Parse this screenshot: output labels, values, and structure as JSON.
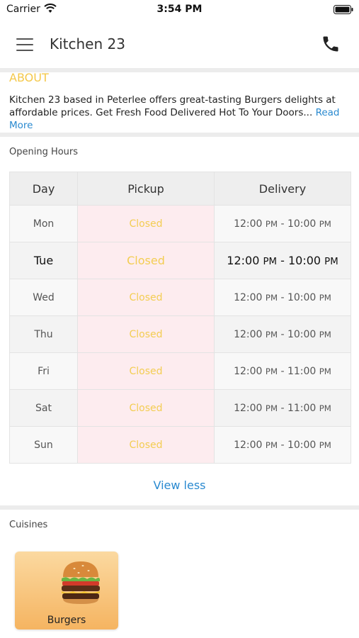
{
  "status_bar": {
    "carrier": "Carrier",
    "time": "3:54 PM"
  },
  "app_bar": {
    "title": "Kitchen 23"
  },
  "about": {
    "title": "ABOUT",
    "text": "Kitchen 23 based in Peterlee offers great-tasting Burgers delights at affordable prices. Get Fresh Food Delivered Hot To Your Doors",
    "ellipsis": "...",
    "read_more": "Read More"
  },
  "opening_hours": {
    "label": "Opening Hours",
    "headers": {
      "day": "Day",
      "pickup": "Pickup",
      "delivery": "Delivery"
    },
    "rows": [
      {
        "day": "Mon",
        "pickup": "Closed",
        "delivery_start": "12:00",
        "delivery_start_suffix": "PM",
        "delivery_end": "10:00",
        "delivery_end_suffix": "PM"
      },
      {
        "day": "Tue",
        "pickup": "Closed",
        "delivery_start": "12:00",
        "delivery_start_suffix": "PM",
        "delivery_end": "10:00",
        "delivery_end_suffix": "PM"
      },
      {
        "day": "Wed",
        "pickup": "Closed",
        "delivery_start": "12:00",
        "delivery_start_suffix": "PM",
        "delivery_end": "10:00",
        "delivery_end_suffix": "PM"
      },
      {
        "day": "Thu",
        "pickup": "Closed",
        "delivery_start": "12:00",
        "delivery_start_suffix": "PM",
        "delivery_end": "10:00",
        "delivery_end_suffix": "PM"
      },
      {
        "day": "Fri",
        "pickup": "Closed",
        "delivery_start": "12:00",
        "delivery_start_suffix": "PM",
        "delivery_end": "11:00",
        "delivery_end_suffix": "PM"
      },
      {
        "day": "Sat",
        "pickup": "Closed",
        "delivery_start": "12:00",
        "delivery_start_suffix": "PM",
        "delivery_end": "11:00",
        "delivery_end_suffix": "PM"
      },
      {
        "day": "Sun",
        "pickup": "Closed",
        "delivery_start": "12:00",
        "delivery_start_suffix": "PM",
        "delivery_end": "10:00",
        "delivery_end_suffix": "PM"
      }
    ],
    "view_less": "View less"
  },
  "cuisines": {
    "label": "Cuisines",
    "items": [
      {
        "name": "Burgers",
        "icon": "burger-image"
      }
    ]
  },
  "colors": {
    "accent_yellow": "#f4c84a",
    "link_blue": "#2a8ad0",
    "closed_bg": "#fdecef"
  }
}
